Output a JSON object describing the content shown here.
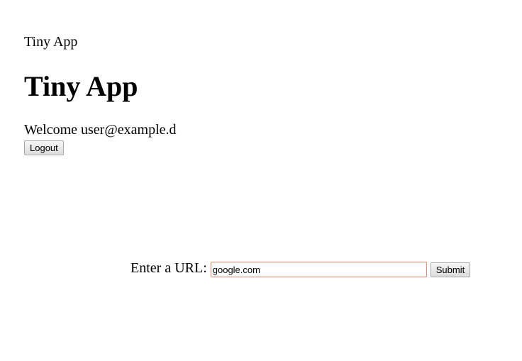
{
  "header": {
    "app_label": "Tiny App",
    "title": "Tiny App"
  },
  "user": {
    "welcome_text": "Welcome user@example.d",
    "logout_label": "Logout"
  },
  "url_form": {
    "label": "Enter a URL:",
    "input_value": "google.com",
    "submit_label": "Submit"
  },
  "colors": {
    "input_border": "#e0876a"
  }
}
